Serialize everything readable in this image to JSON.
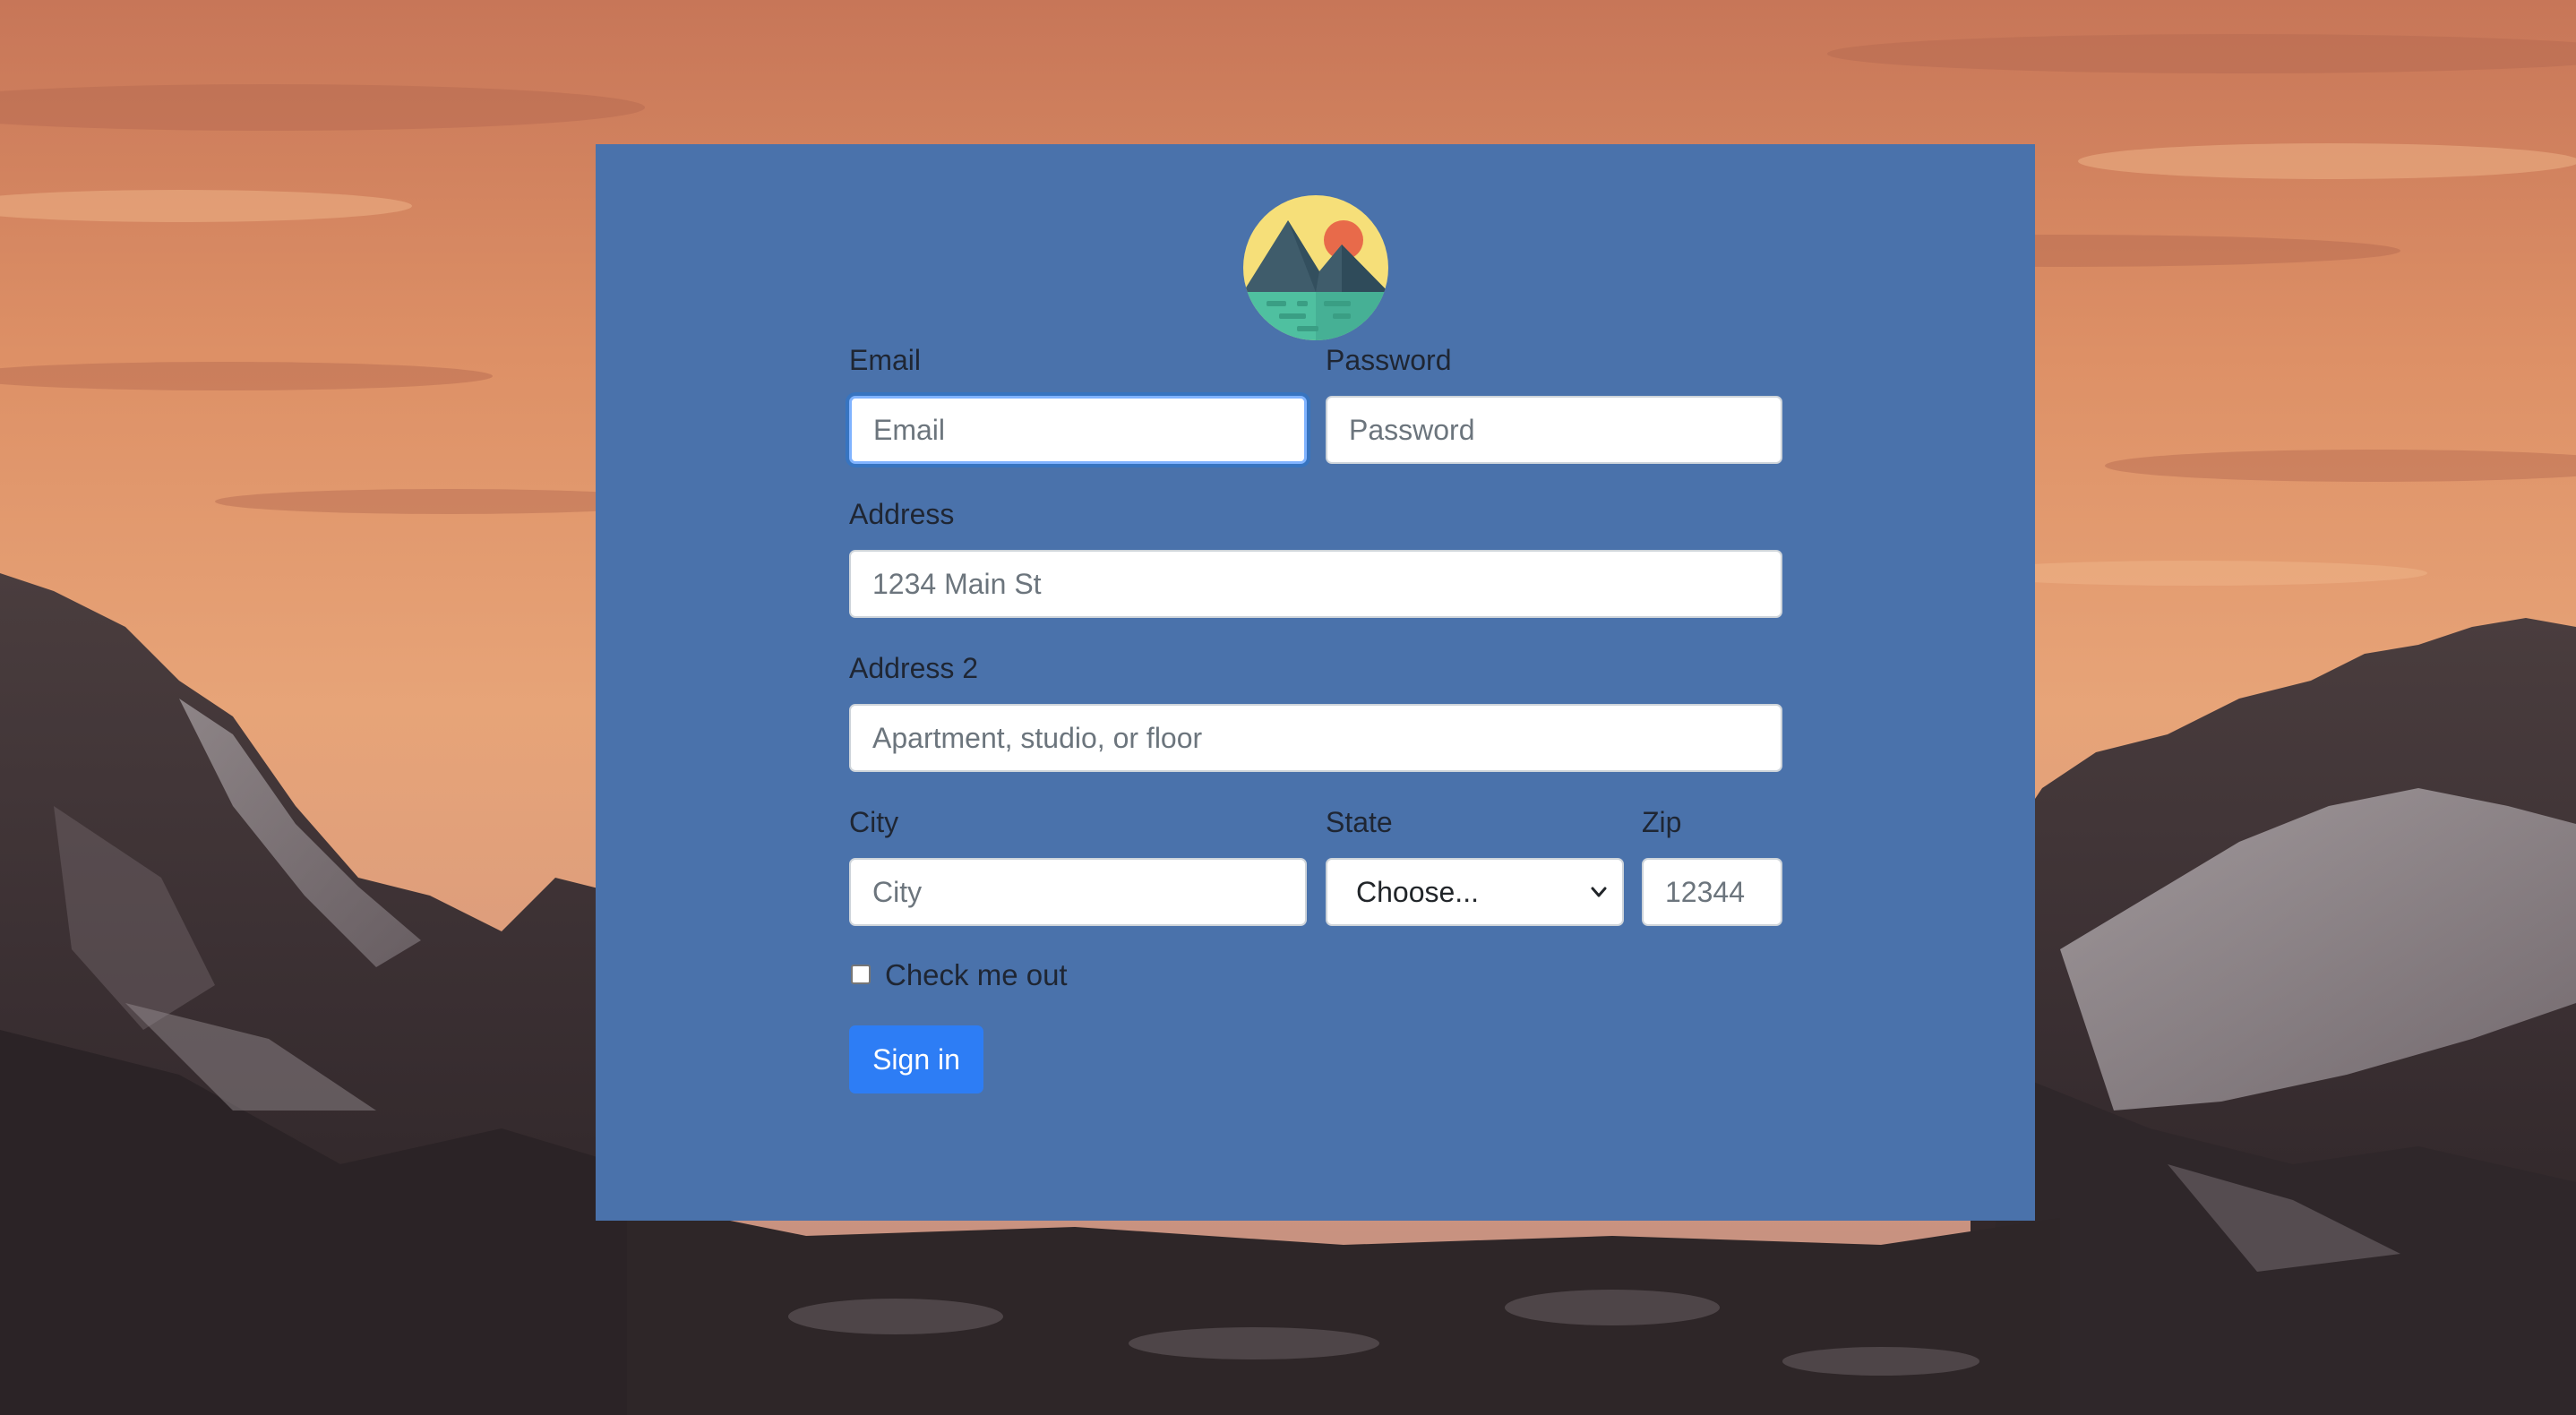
{
  "form": {
    "email": {
      "label": "Email",
      "placeholder": "Email",
      "focused": true
    },
    "password": {
      "label": "Password",
      "placeholder": "Password"
    },
    "address": {
      "label": "Address",
      "placeholder": "1234 Main St"
    },
    "address2": {
      "label": "Address 2",
      "placeholder": "Apartment, studio, or floor"
    },
    "city": {
      "label": "City",
      "placeholder": "City"
    },
    "state": {
      "label": "State",
      "selected": "Choose..."
    },
    "zip": {
      "label": "Zip",
      "placeholder": "12344"
    },
    "checkbox": {
      "label": "Check me out",
      "checked": false
    },
    "submit": {
      "label": "Sign in"
    }
  },
  "icons": {
    "logo": "mountain-logo-icon",
    "select_arrow": "chevron-down-icon"
  },
  "colors": {
    "panel": "#4a72ab",
    "button": "#2d7df5",
    "label_text": "#1f2633",
    "placeholder": "#6c757d"
  }
}
